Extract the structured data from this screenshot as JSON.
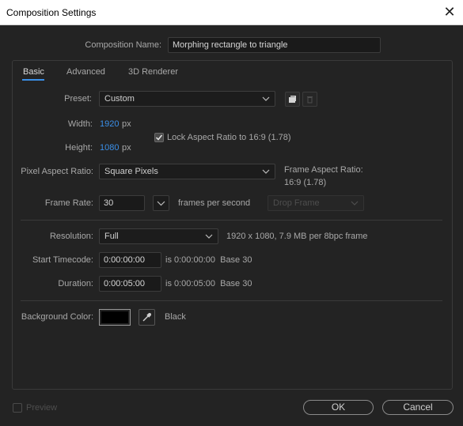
{
  "window": {
    "title": "Composition Settings",
    "close_glyph": "✕"
  },
  "composition_name": {
    "label": "Composition Name:",
    "value": "Morphing rectangle to triangle"
  },
  "tabs": [
    {
      "label": "Basic",
      "active": true
    },
    {
      "label": "Advanced",
      "active": false
    },
    {
      "label": "3D Renderer",
      "active": false
    }
  ],
  "preset": {
    "label": "Preset:",
    "value": "Custom",
    "icons": [
      "save-preset-icon",
      "delete-preset-icon"
    ]
  },
  "width": {
    "label": "Width:",
    "value": "1920",
    "unit": "px"
  },
  "height": {
    "label": "Height:",
    "value": "1080",
    "unit": "px"
  },
  "lock_aspect": {
    "label": "Lock Aspect Ratio to 16:9 (1.78)",
    "checked": true
  },
  "pixel_aspect": {
    "label": "Pixel Aspect Ratio:",
    "value": "Square Pixels"
  },
  "frame_aspect": {
    "label": "Frame Aspect Ratio:",
    "value": "16:9 (1.78)"
  },
  "frame_rate": {
    "label": "Frame Rate:",
    "value": "30",
    "unit": "frames per second",
    "drop_frame": "Drop Frame"
  },
  "resolution": {
    "label": "Resolution:",
    "value": "Full",
    "info": "1920 x 1080, 7.9 MB per 8bpc frame"
  },
  "start_timecode": {
    "label": "Start Timecode:",
    "value": "0:00:00:00",
    "info": "is 0:00:00:00  Base 30"
  },
  "duration": {
    "label": "Duration:",
    "value": "0:00:05:00",
    "info": "is 0:00:05:00  Base 30"
  },
  "background_color": {
    "label": "Background Color:",
    "name": "Black",
    "color": "#000000"
  },
  "footer": {
    "preview_label": "Preview",
    "preview_checked": false,
    "ok_label": "OK",
    "cancel_label": "Cancel"
  },
  "colors": {
    "accent": "#3a8fe8",
    "background": "#232323"
  }
}
